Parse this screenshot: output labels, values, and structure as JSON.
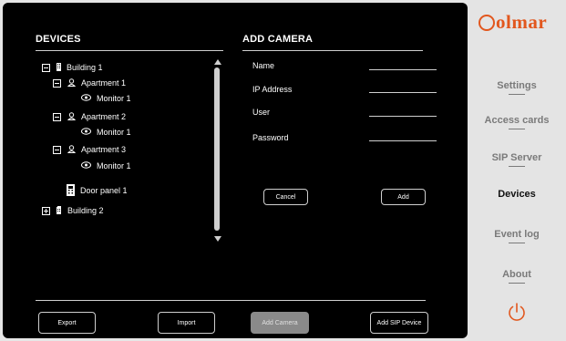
{
  "brand": {
    "logo_text": "olmar",
    "logo_prefix": "G",
    "color": "#e2571e"
  },
  "devices_panel": {
    "title": "DEVICES",
    "tree": [
      {
        "label": "Building 1",
        "expand": "minus",
        "icon": "building-icon",
        "level": 0
      },
      {
        "label": "Apartment 1",
        "expand": "minus",
        "icon": "apartment-icon",
        "level": 1
      },
      {
        "label": "Monitor 1",
        "expand": "",
        "icon": "monitor-icon",
        "level": 2
      },
      {
        "label": "Apartment 2",
        "expand": "minus",
        "icon": "apartment-icon",
        "level": 1
      },
      {
        "label": "Monitor 1",
        "expand": "",
        "icon": "monitor-icon",
        "level": 2
      },
      {
        "label": "Apartment 3",
        "expand": "minus",
        "icon": "apartment-icon",
        "level": 1
      },
      {
        "label": "Monitor 1",
        "expand": "",
        "icon": "monitor-icon",
        "level": 2
      },
      {
        "label": "Door panel 1",
        "expand": "",
        "icon": "door-panel-icon",
        "level": 1
      },
      {
        "label": "Building 2",
        "expand": "plus",
        "icon": "building-icon",
        "level": 0
      }
    ]
  },
  "add_camera": {
    "title": "ADD CAMERA",
    "fields": [
      {
        "label": "Name",
        "value": ""
      },
      {
        "label": "IP Address",
        "value": ""
      },
      {
        "label": "User",
        "value": ""
      },
      {
        "label": "Password",
        "value": ""
      }
    ],
    "cancel_label": "Cancel",
    "add_label": "Add"
  },
  "footer": {
    "export_label": "Export",
    "import_label": "Import",
    "add_camera_label": "Add Camera",
    "add_sip_label": "Add SIP Device"
  },
  "menu": {
    "items": [
      {
        "label": "Settings",
        "active": false
      },
      {
        "label": "Access cards",
        "active": false
      },
      {
        "label": "SIP Server",
        "active": false
      },
      {
        "label": "Devices",
        "active": true
      },
      {
        "label": "Event log",
        "active": false
      },
      {
        "label": "About",
        "active": false
      }
    ],
    "power_icon": "power-icon",
    "power_color": "#e2571e"
  }
}
